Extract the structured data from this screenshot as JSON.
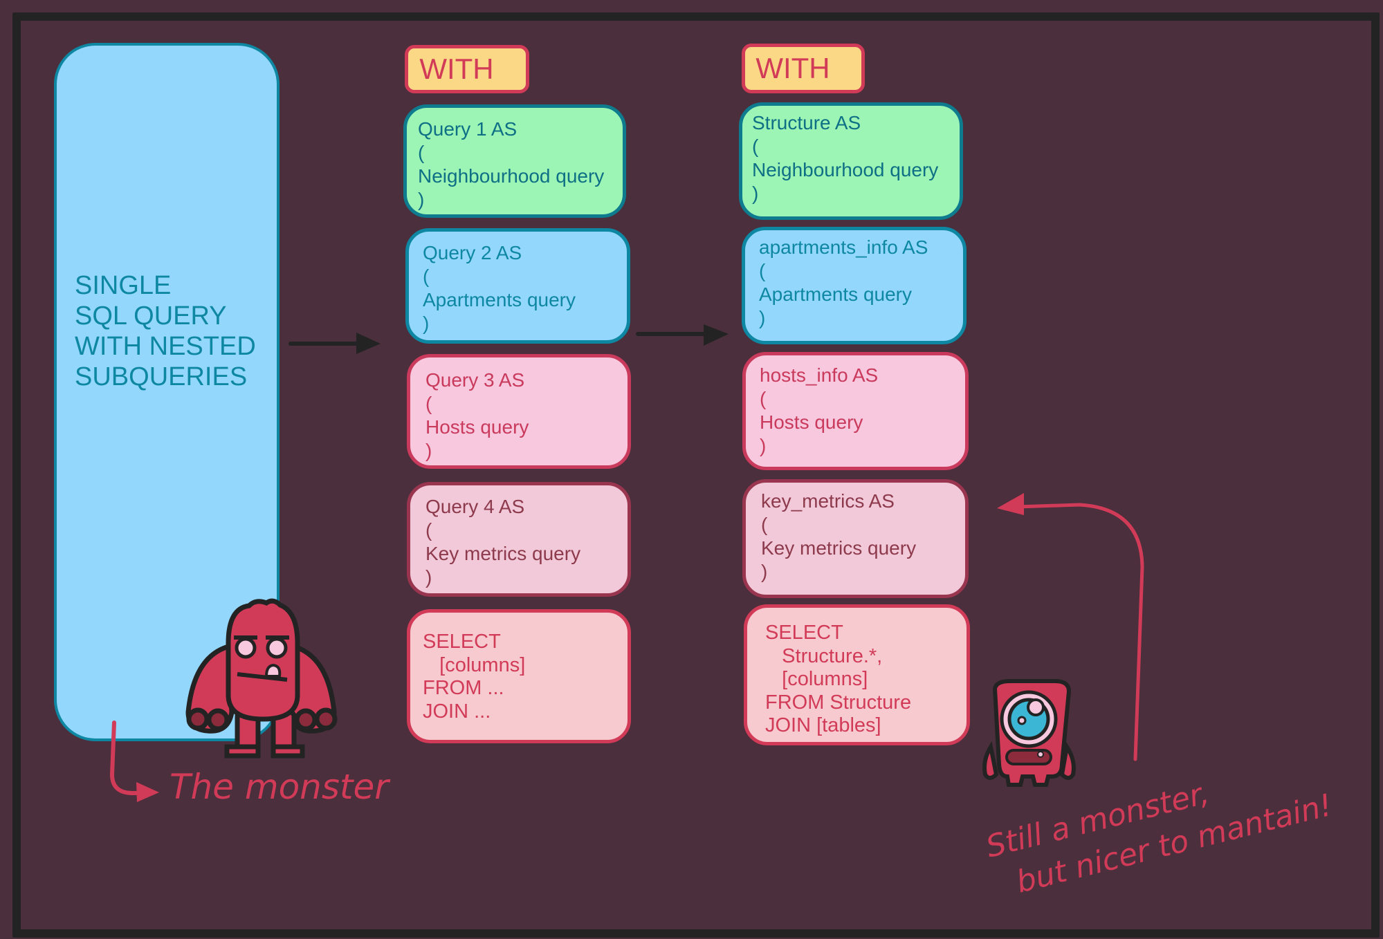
{
  "colors": {
    "background": "#4b2f3c",
    "frame": "#232323",
    "blue_fill": "#93d8fc",
    "teal": "#0e87a3",
    "green_fill": "#9cf5b5",
    "pink_fill": "#f7c8de",
    "select_fill": "#f7cacf",
    "accent_red": "#d23b58",
    "with_fill": "#fbd886"
  },
  "monolith": {
    "lines": [
      "SINGLE",
      "SQL QUERY",
      "WITH NESTED",
      "SUBQUERIES"
    ],
    "annotation": "The monster"
  },
  "generic_cte": {
    "with_label": "WITH",
    "blocks": [
      {
        "text": "Query 1 AS\n(\nNeighbourhood query\n)"
      },
      {
        "text": "Query 2 AS\n(\nApartments query\n)"
      },
      {
        "text": "Query 3 AS\n(\nHosts query\n)"
      },
      {
        "text": "Query 4 AS\n(\nKey metrics query\n)"
      },
      {
        "text": "SELECT\n   [columns]\nFROM ...\nJOIN ..."
      }
    ]
  },
  "named_cte": {
    "with_label": "WITH",
    "blocks": [
      {
        "text": "Structure AS\n(\nNeighbourhood query\n)"
      },
      {
        "text": "apartments_info AS\n(\nApartments query\n)"
      },
      {
        "text": "hosts_info AS\n(\nHosts query\n)"
      },
      {
        "text": "key_metrics AS\n(\nKey metrics query\n)"
      },
      {
        "text": "SELECT\n   Structure.*,\n   [columns]\nFROM Structure\nJOIN [tables]"
      }
    ],
    "annotation_line1": "Still a monster,",
    "annotation_line2": "but nicer to mantain!"
  },
  "icons": [
    "arrow-right-icon",
    "arrow-right-icon",
    "curved-arrow-icon",
    "monster-grumpy-icon",
    "monster-cyclops-icon"
  ]
}
